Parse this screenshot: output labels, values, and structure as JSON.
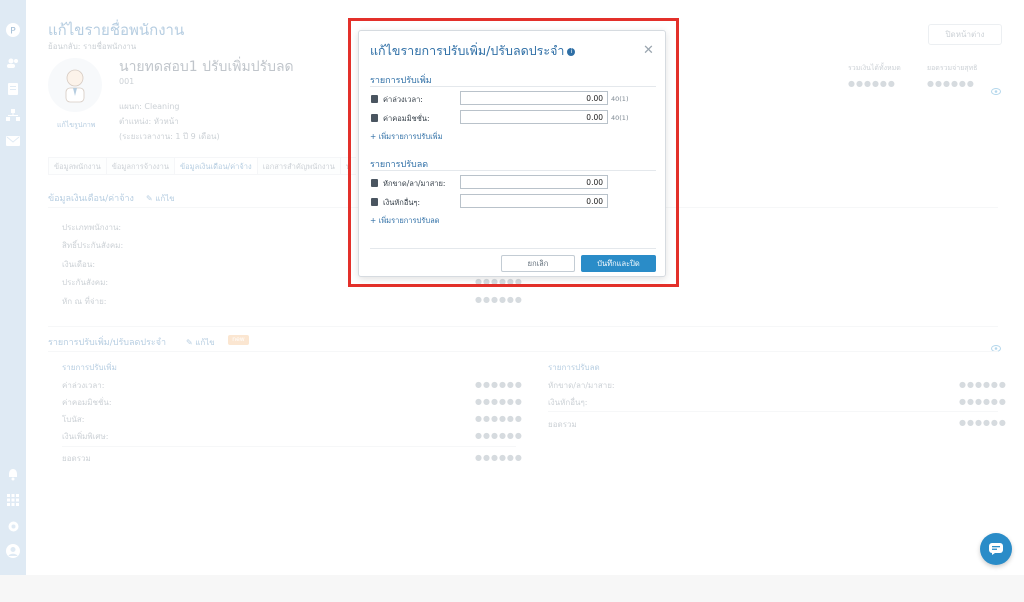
{
  "sidebar": {
    "icons": [
      "logo-icon",
      "users-icon",
      "document-icon",
      "org-chart-icon",
      "inbox-icon",
      "bell-icon",
      "apps-grid-icon",
      "gear-icon",
      "profile-icon"
    ]
  },
  "page": {
    "title": "แก้ไขรายชื่อพนักงาน",
    "back_link": "ย้อนกลับ: รายชื่อพนักงาน",
    "close_page_button": "ปิดหน้าต่าง",
    "employee_name": "นายทดสอบ1 ปรับเพิ่มปรับลด",
    "employee_code": "001",
    "department": "แผนก: Cleaning",
    "position": "ตำแหน่ง: หัวหน้า",
    "tenure": "(ระยะเวลางาน: 1 ปี 9 เดือน)",
    "avatar_caption": "แก้ไขรูปภาพ",
    "summary_income_label": "รวมเงินได้ทั้งหมด",
    "summary_net_label": "ยอดรวมจ่ายสุทธิ",
    "masked_value": "●●●●●●",
    "tabs": [
      "ข้อมูลพนักงาน",
      "ข้อมูลการจ้างงาน",
      "ข้อมูลเงินเดือน/ค่าจ้าง",
      "เอกสารสำคัญพนักงาน",
      "บ"
    ],
    "salary_section": "ข้อมูลเงินเดือน/ค่าจ้าง",
    "edit_label": "แก้ไข",
    "salary_fields": [
      "ประเภทพนักงาน:",
      "สิทธิ์ประกันสังคม:",
      "เงินเดือน:",
      "ประกันสังคม:",
      "หัก ณ ที่จ่าย:"
    ],
    "adjust_section": "รายการปรับเพิ่ม/ปรับลดประจำ",
    "adjust_badge": "new",
    "increase_heading": "รายการปรับเพิ่ม",
    "increase_fields": [
      "ค่าล่วงเวลา:",
      "ค่าคอมมิชชั่น:",
      "โบนัส:",
      "เงินเพิ่มพิเศษ:"
    ],
    "decrease_heading": "รายการปรับลด",
    "decrease_fields": [
      "หักขาด/ลา/มาสาย:",
      "เงินหักอื่นๆ:"
    ],
    "total_label": "ยอดรวม"
  },
  "modal": {
    "title": "แก้ไขรายการปรับเพิ่ม/ปรับลดประจำ",
    "increase_section": "รายการปรับเพิ่ม",
    "increase_rows": [
      {
        "label": "ค่าล่วงเวลา:",
        "value": "0.00",
        "note": "40(1)"
      },
      {
        "label": "ค่าคอมมิชชั่น:",
        "value": "0.00",
        "note": "40(1)"
      }
    ],
    "add_increase": "+ เพิ่มรายการปรับเพิ่ม",
    "decrease_section": "รายการปรับลด",
    "decrease_rows": [
      {
        "label": "หักขาด/ลา/มาสาย:",
        "value": "0.00"
      },
      {
        "label": "เงินหักอื่นๆ:",
        "value": "0.00"
      }
    ],
    "add_decrease": "+ เพิ่มรายการปรับลด",
    "cancel_button": "ยกเลิก",
    "save_button": "บันทึกและปิด"
  },
  "colors": {
    "accent": "#2f6fa6",
    "primary_button": "#2a8cc8",
    "highlight_frame": "#e3302a",
    "sidebar": "#dfeaf4"
  }
}
